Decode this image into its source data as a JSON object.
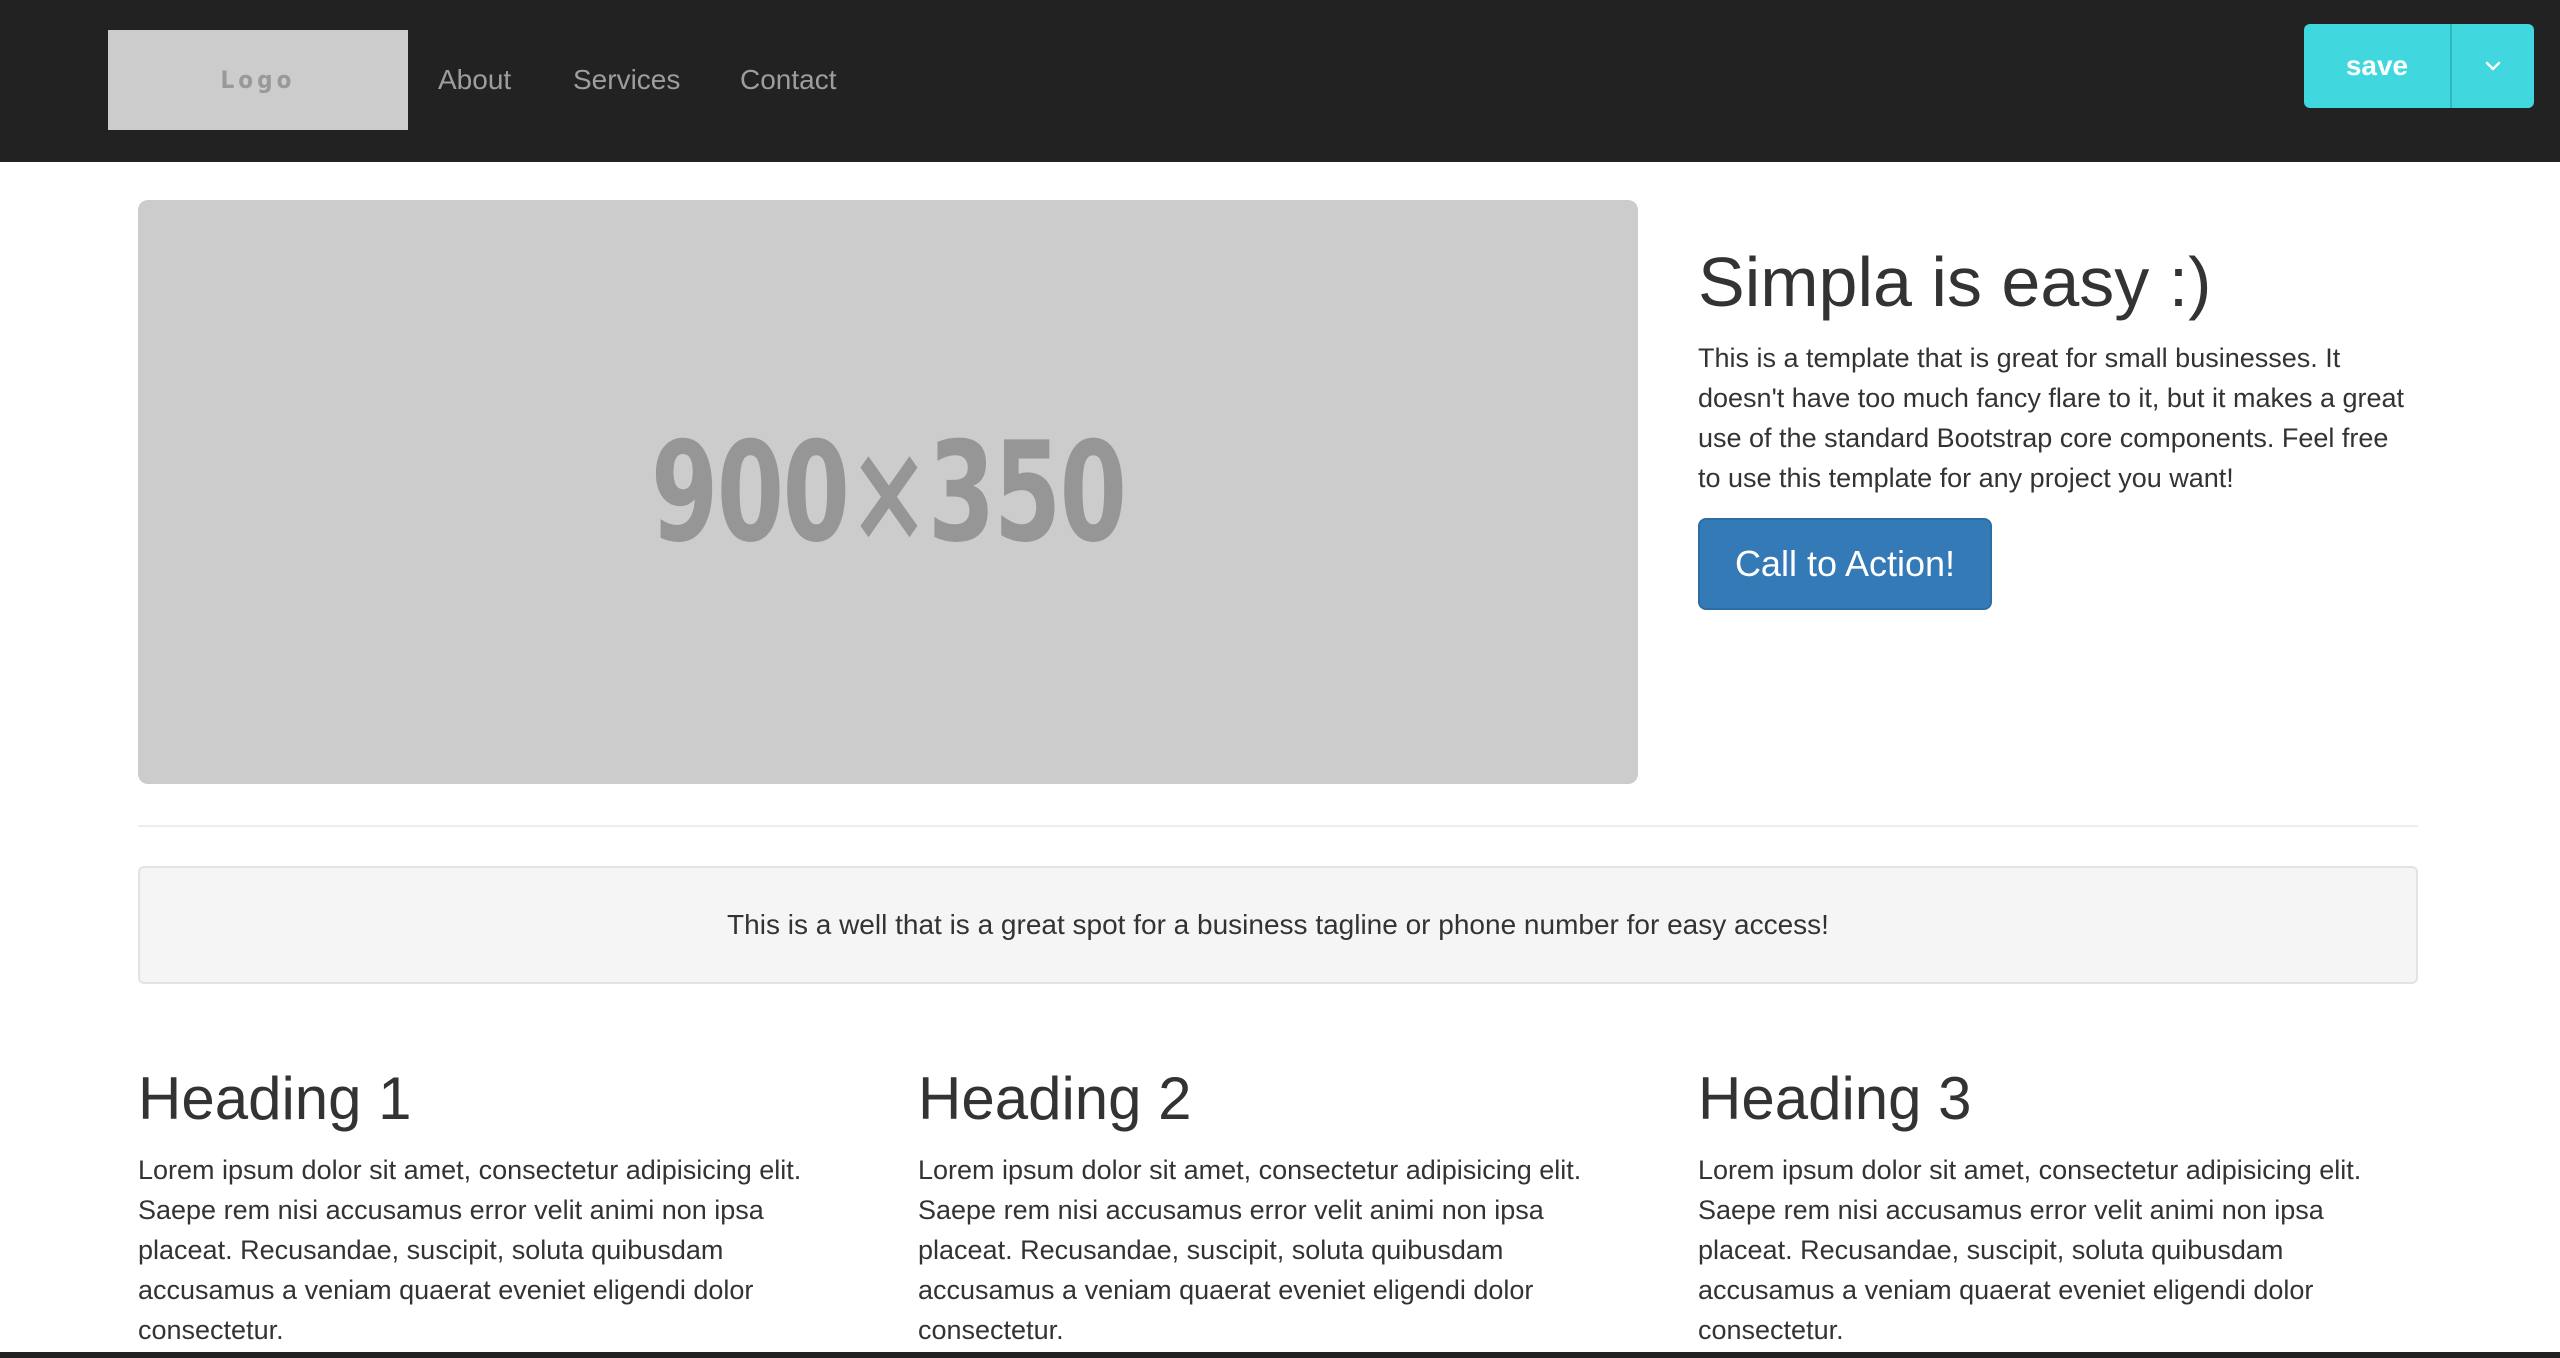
{
  "navbar": {
    "logo_text": "Logo",
    "links": [
      "About",
      "Services",
      "Contact"
    ],
    "save_label": "save",
    "save_dropdown_icon": "chevron-down-icon"
  },
  "hero": {
    "image_text": "900×350",
    "title": "Simpla is easy :)",
    "text": "This is a template that is great for small businesses. It doesn't have too much fancy flare to it, but it makes a great use of the standard Bootstrap core components. Feel free to use this template for any project you want!",
    "cta_label": "Call to Action!"
  },
  "well": {
    "text": "This is a well that is a great spot for a business tagline or phone number for easy access!"
  },
  "columns": [
    {
      "heading": "Heading 1",
      "text": "Lorem ipsum dolor sit amet, consectetur adipisicing elit. Saepe rem nisi accusamus error velit animi non ipsa placeat. Recusandae, suscipit, soluta quibusdam accusamus a veniam quaerat eveniet eligendi dolor consectetur."
    },
    {
      "heading": "Heading 2",
      "text": "Lorem ipsum dolor sit amet, consectetur adipisicing elit. Saepe rem nisi accusamus error velit animi non ipsa placeat. Recusandae, suscipit, soluta quibusdam accusamus a veniam quaerat eveniet eligendi dolor consectetur."
    },
    {
      "heading": "Heading 3",
      "text": "Lorem ipsum dolor sit amet, consectetur adipisicing elit. Saepe rem nisi accusamus error velit animi non ipsa placeat. Recusandae, suscipit, soluta quibusdam accusamus a veniam quaerat eveniet eligendi dolor consectetur."
    }
  ],
  "colors": {
    "navbar_bg": "#222222",
    "save_button": "#40d8de",
    "cta_button": "#337ab7",
    "placeholder_bg": "#cccccc"
  }
}
